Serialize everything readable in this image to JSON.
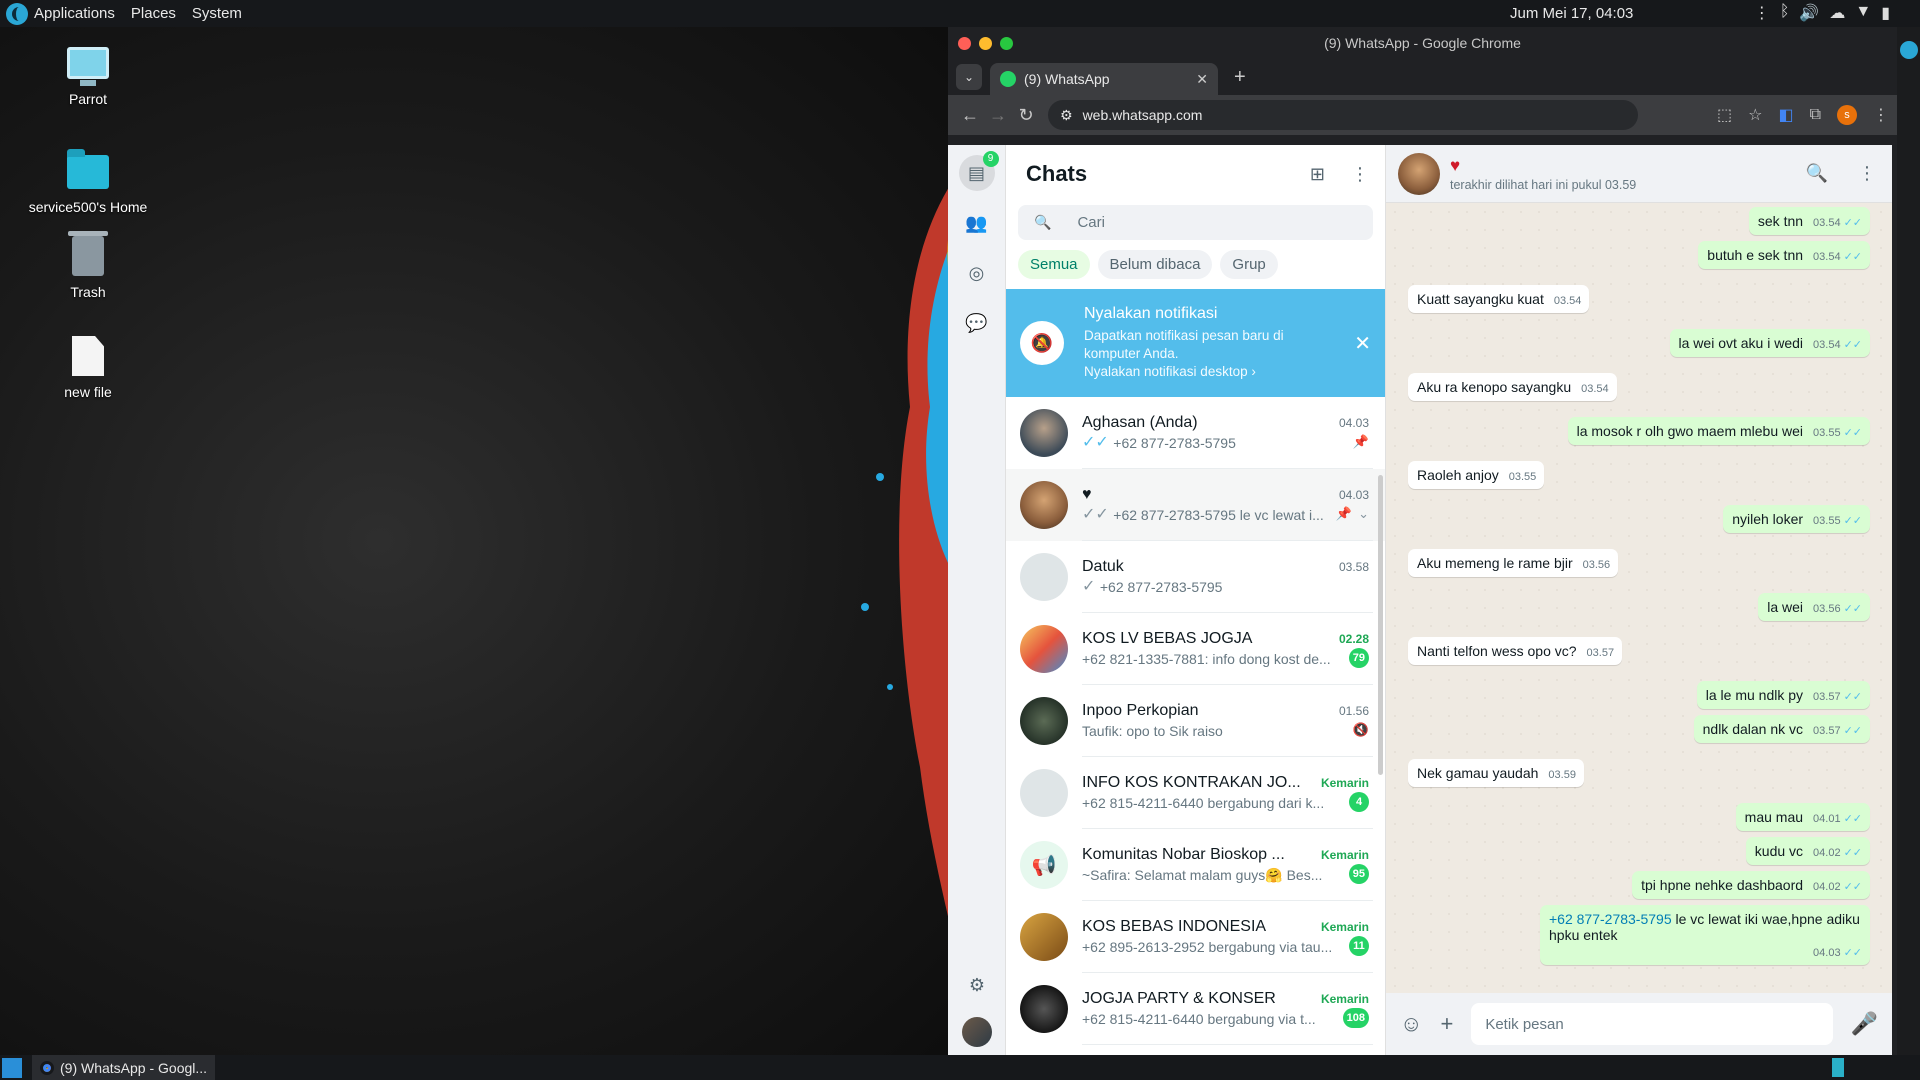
{
  "panel": {
    "menus": [
      "Applications",
      "Places",
      "System"
    ],
    "clock": "Jum Mei 17, 04:03"
  },
  "desktop": {
    "icons": [
      {
        "label": "Parrot",
        "icon": "monitor-icon"
      },
      {
        "label": "service500's Home",
        "icon": "home-folder-icon"
      },
      {
        "label": "Trash",
        "icon": "trash-icon"
      },
      {
        "label": "new file",
        "icon": "file-icon"
      }
    ]
  },
  "browser": {
    "window_title": "(9) WhatsApp - Google Chrome",
    "tab_title": "(9) WhatsApp",
    "url": "web.whatsapp.com",
    "profile_initial": "s",
    "colors": {
      "close": "#ff5f57",
      "minimize": "#febc2e",
      "maximize": "#28c840"
    }
  },
  "wa": {
    "rail_badge": "9",
    "sidebar_title": "Chats",
    "search_placeholder": "Cari",
    "filters": [
      "Semua",
      "Belum dibaca",
      "Grup"
    ],
    "notification": {
      "title": "Nyalakan notifikasi",
      "line1": "Dapatkan notifikasi pesan baru di",
      "line2": "komputer Anda.",
      "action": "Nyalakan notifikasi desktop ›"
    },
    "chats": [
      {
        "name": "Aghasan (Anda)",
        "time": "04.03",
        "msg": "+62 877-2783-5795",
        "tick": "✓✓",
        "pinned": true
      },
      {
        "name": "♥",
        "time": "04.03",
        "msg": "+62 877-2783-5795 le vc lewat i...",
        "tick": "✓✓",
        "pinned": true
      },
      {
        "name": "Datuk",
        "time": "03.58",
        "msg": "+62 877-2783-5795",
        "tick": "✓"
      },
      {
        "name": "KOS LV BEBAS JOGJA",
        "time": "02.28",
        "msg": "+62 821-1335-7881: info dong kost de...",
        "unread": "79"
      },
      {
        "name": "Inpoo Perkopian",
        "time": "01.56",
        "msg": "Taufik: opo to Sik raiso",
        "muted": true
      },
      {
        "name": "INFO KOS KONTRAKAN JO...",
        "time": "Kemarin",
        "msg": "+62 815-4211-6440 bergabung dari k...",
        "unread": "4"
      },
      {
        "name": "Komunitas Nobar Bioskop ...",
        "time": "Kemarin",
        "msg": "~Safira: Selamat malam guys🤗 Bes...",
        "unread": "95"
      },
      {
        "name": "KOS BEBAS INDONESIA",
        "time": "Kemarin",
        "msg": "+62 895-2613-2952 bergabung via tau...",
        "unread": "11"
      },
      {
        "name": "JOGJA PARTY & KONSER",
        "time": "Kemarin",
        "msg": "+62 815-4211-6440 bergabung via t...",
        "unread": "108"
      }
    ],
    "conversation": {
      "contact_name": "♥",
      "status": "terakhir dilihat hari ini pukul 03.59",
      "composer_placeholder": "Ketik pesan",
      "messages": [
        {
          "dir": "out",
          "text": "sek tnn",
          "time": "03.54"
        },
        {
          "dir": "out",
          "text": "butuh e sek tnn",
          "time": "03.54"
        },
        {
          "dir": "in",
          "text": "Kuatt sayangku kuat",
          "time": "03.54"
        },
        {
          "dir": "out",
          "text": "la wei ovt aku i wedi",
          "time": "03.54"
        },
        {
          "dir": "in",
          "text": "Aku ra kenopo sayangku",
          "time": "03.54"
        },
        {
          "dir": "out",
          "text": "la mosok r olh gwo maem mlebu wei",
          "time": "03.55"
        },
        {
          "dir": "in",
          "text": "Raoleh anjoy",
          "time": "03.55"
        },
        {
          "dir": "out",
          "text": "nyileh loker",
          "time": "03.55"
        },
        {
          "dir": "in",
          "text": "Aku memeng le rame bjir",
          "time": "03.56"
        },
        {
          "dir": "out",
          "text": "la wei",
          "time": "03.56"
        },
        {
          "dir": "in",
          "text": "Nanti telfon wess opo vc?",
          "time": "03.57"
        },
        {
          "dir": "out",
          "text": "la le mu ndlk py",
          "time": "03.57"
        },
        {
          "dir": "out",
          "text": "ndlk dalan nk vc",
          "time": "03.57"
        },
        {
          "dir": "in",
          "text": "Nek gamau yaudah",
          "time": "03.59"
        },
        {
          "dir": "out",
          "text": "mau mau",
          "time": "04.01"
        },
        {
          "dir": "out",
          "text": "kudu vc",
          "time": "04.02"
        },
        {
          "dir": "out",
          "text": "tpi hpne nehke dashbaord",
          "time": "04.02"
        },
        {
          "dir": "out",
          "link": "+62 877-2783-5795",
          "text": " le vc lewat iki wae,hpne adiku hpku entek",
          "time": "04.03"
        }
      ]
    }
  },
  "taskbar": {
    "task_label": "(9) WhatsApp - Googl..."
  }
}
